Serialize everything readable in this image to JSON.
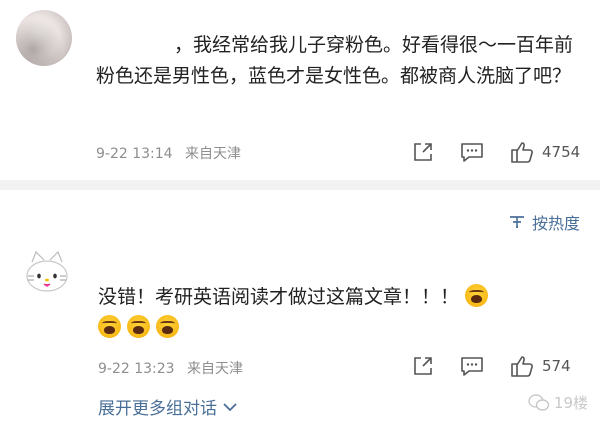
{
  "comments": [
    {
      "text": "，我经常给我儿子穿粉色。好看得很～一百年前粉色还是男性色，蓝色才是女性色。都被商人洗脑了吧？",
      "date": "9-22 13:14",
      "source": "来自天津",
      "likes": "4754"
    },
    {
      "text": "没错！考研英语阅读才做过这篇文章！！！",
      "date": "9-22 13:23",
      "source": "来自天津",
      "likes": "574"
    }
  ],
  "sort": {
    "label": "按热度"
  },
  "expand": {
    "label": "展开更多组对话"
  },
  "watermark": {
    "label": "19楼"
  },
  "colors": {
    "link": "#4a6f97",
    "meta": "#8e8e8e",
    "divider": "#f2f2f2"
  }
}
